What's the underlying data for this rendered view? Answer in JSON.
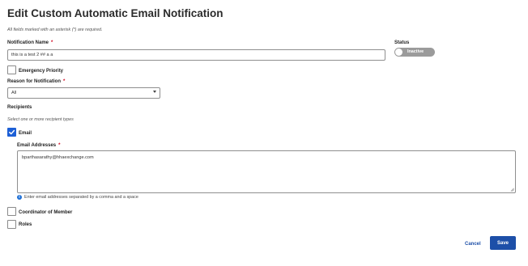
{
  "page": {
    "title": "Edit Custom Automatic Email Notification",
    "required_hint": "All fields marked with an asterisk (*) are required."
  },
  "form": {
    "notification_name": {
      "label": "Notification Name",
      "required_mark": "*",
      "value": "this is a test 2 ## a a"
    },
    "status": {
      "label": "Status",
      "toggle_label": "Inactive",
      "active": false
    },
    "emergency_priority": {
      "label": "Emergency Priority",
      "checked": false
    },
    "reason": {
      "label": "Reason for Notification",
      "required_mark": "*",
      "selected": "All"
    },
    "recipients": {
      "label": "Recipients",
      "hint": "Select one or more recipient types",
      "email": {
        "label": "Email",
        "checked": true,
        "addresses_label": "Email Addresses",
        "required_mark": "*",
        "addresses_value": "bparthasarathy@hhaexchange.com",
        "info": "Enter email addresses separated by a comma and a space"
      },
      "coordinator": {
        "label": "Coordinator of Member",
        "checked": false
      },
      "roles": {
        "label": "Roles",
        "checked": false
      }
    }
  },
  "actions": {
    "cancel_label": "Cancel",
    "save_label": "Save"
  },
  "colors": {
    "accent": "#1d4fa8",
    "checkbox_checked": "#1d5fd6",
    "required": "#d0021b",
    "toggle_off": "#9b9b9b"
  },
  "icons": {
    "checkmark": "check-icon",
    "dropdown": "chevron-down-icon",
    "info": "info-icon",
    "resize": "resize-handle-icon"
  }
}
